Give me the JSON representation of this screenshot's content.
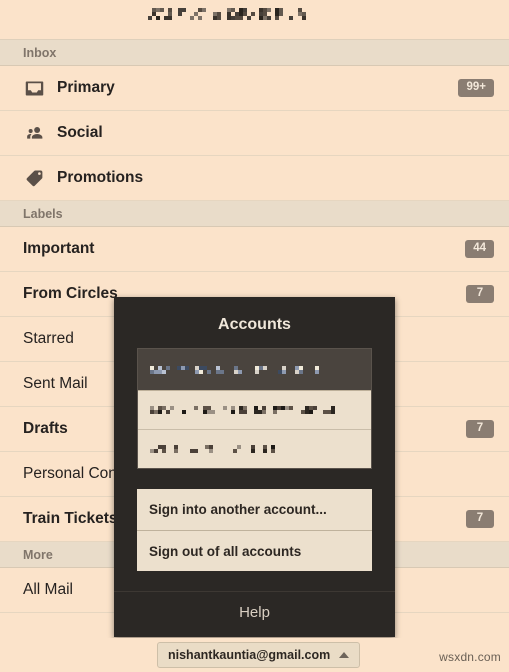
{
  "window": {
    "header_redacted": true,
    "background_color": "#fbe3ca",
    "section_header_color": "#e9dcc9",
    "badge_color": "#8a7d72",
    "dialog_color": "#2b2825"
  },
  "sections": [
    {
      "id": "inbox",
      "label": "Inbox"
    },
    {
      "id": "labels",
      "label": "Labels"
    },
    {
      "id": "more",
      "label": "More"
    }
  ],
  "inbox_items": [
    {
      "label": "Primary",
      "icon": "inbox-icon",
      "bold": true,
      "badge": "99+"
    },
    {
      "label": "Social",
      "icon": "people-icon",
      "bold": true,
      "badge": ""
    },
    {
      "label": "Promotions",
      "icon": "tag-icon",
      "bold": true,
      "badge": ""
    }
  ],
  "label_items": [
    {
      "label": "Important",
      "icon": "",
      "bold": true,
      "badge": "44"
    },
    {
      "label": "From Circles",
      "icon": "",
      "bold": true,
      "badge": "7"
    },
    {
      "label": "Starred",
      "icon": "",
      "bold": false,
      "badge": ""
    },
    {
      "label": "Sent Mail",
      "icon": "",
      "bold": false,
      "badge": ""
    },
    {
      "label": "Drafts",
      "icon": "",
      "bold": true,
      "badge": "7"
    },
    {
      "label": "Personal Conversations",
      "icon": "",
      "bold": false,
      "badge": ""
    },
    {
      "label": "Train Tickets",
      "icon": "",
      "bold": true,
      "badge": "7"
    }
  ],
  "more_items": [
    {
      "label": "All Mail",
      "icon": "",
      "bold": false,
      "badge": ""
    }
  ],
  "dialog": {
    "title": "Accounts",
    "accounts": [
      {
        "redacted": true,
        "selected": true
      },
      {
        "redacted": true,
        "selected": false
      },
      {
        "redacted": true,
        "selected": false
      }
    ],
    "menu": [
      {
        "label": "Sign into another account..."
      },
      {
        "label": "Sign out of all accounts"
      }
    ],
    "help_label": "Help"
  },
  "bottom_bar": {
    "account_email": "nishantkauntia@gmail.com",
    "caret": "caret-up-icon",
    "watermark": "wsxdn.com"
  }
}
